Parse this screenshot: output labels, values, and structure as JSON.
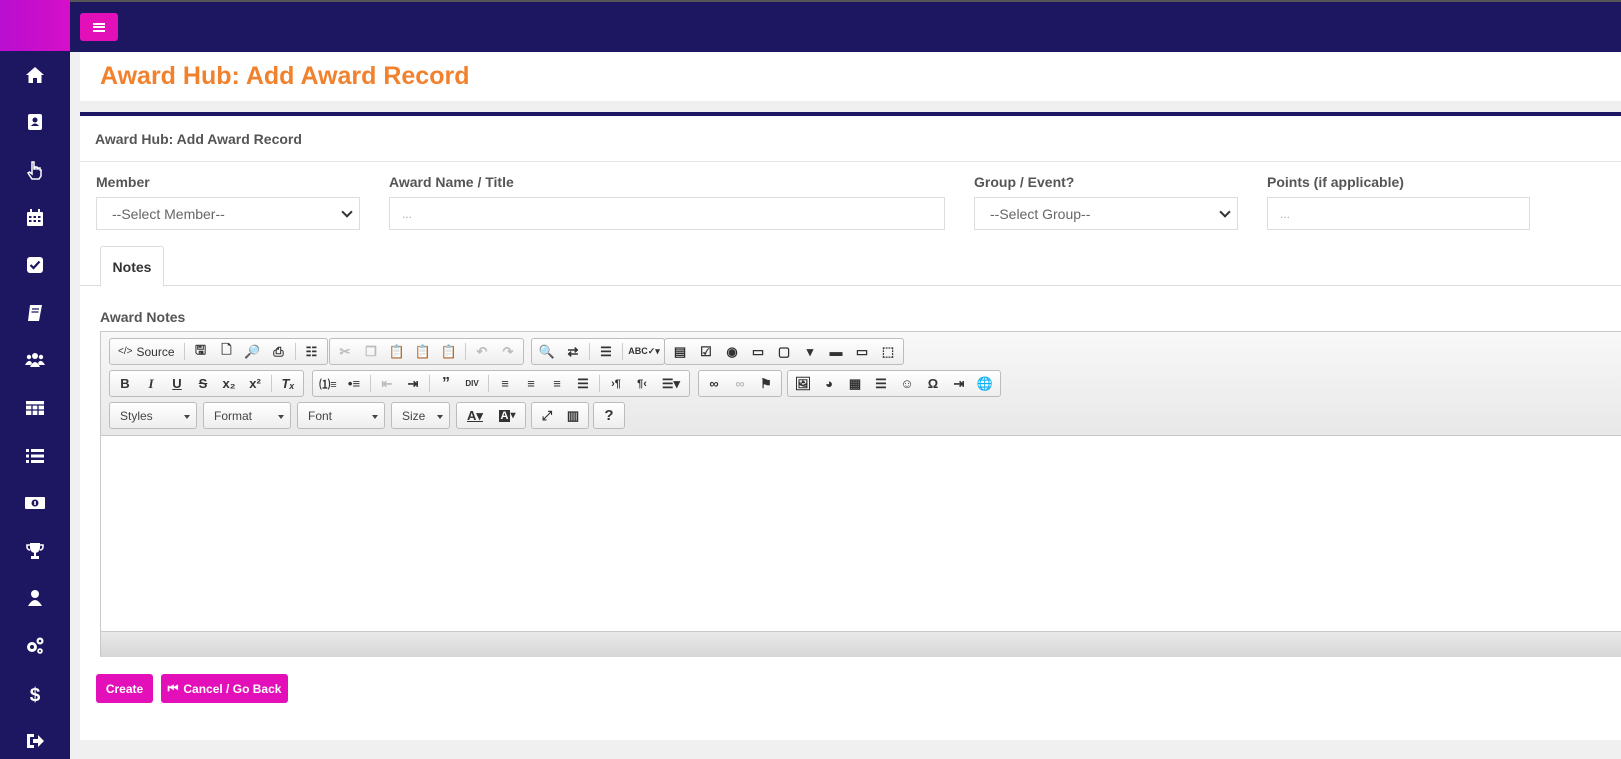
{
  "page": {
    "title": "Award Hub: Add Award Record",
    "card_header": "Award Hub: Add Award Record"
  },
  "sidebar": {
    "items": [
      {
        "icon": "home-icon"
      },
      {
        "icon": "contact-book-icon"
      },
      {
        "icon": "hand-pointer-icon"
      },
      {
        "icon": "calendar-icon"
      },
      {
        "icon": "check-square-icon"
      },
      {
        "icon": "book-icon"
      },
      {
        "icon": "users-icon"
      },
      {
        "icon": "table-icon"
      },
      {
        "icon": "list-icon"
      },
      {
        "icon": "money-bill-icon"
      },
      {
        "icon": "trophy-icon"
      },
      {
        "icon": "user-icon"
      },
      {
        "icon": "cogs-icon"
      },
      {
        "icon": "dollar-icon"
      },
      {
        "icon": "sign-out-icon"
      }
    ]
  },
  "form": {
    "member_label": "Member",
    "member_value": "--Select Member--",
    "award_label": "Award Name / Title",
    "award_placeholder": "...",
    "group_label": "Group / Event?",
    "group_value": "--Select Group--",
    "points_label": "Points (if applicable)",
    "points_placeholder": "..."
  },
  "tabs": {
    "notes": "Notes"
  },
  "editor": {
    "label": "Award Notes",
    "source": "Source",
    "styles": "Styles",
    "format": "Format",
    "font": "Font",
    "size": "Size"
  },
  "actions": {
    "create": "Create",
    "cancel": "Cancel / Go Back"
  },
  "colors": {
    "sidebar": "#1c1760",
    "accent": "#e310b9",
    "title": "#f2812e"
  }
}
